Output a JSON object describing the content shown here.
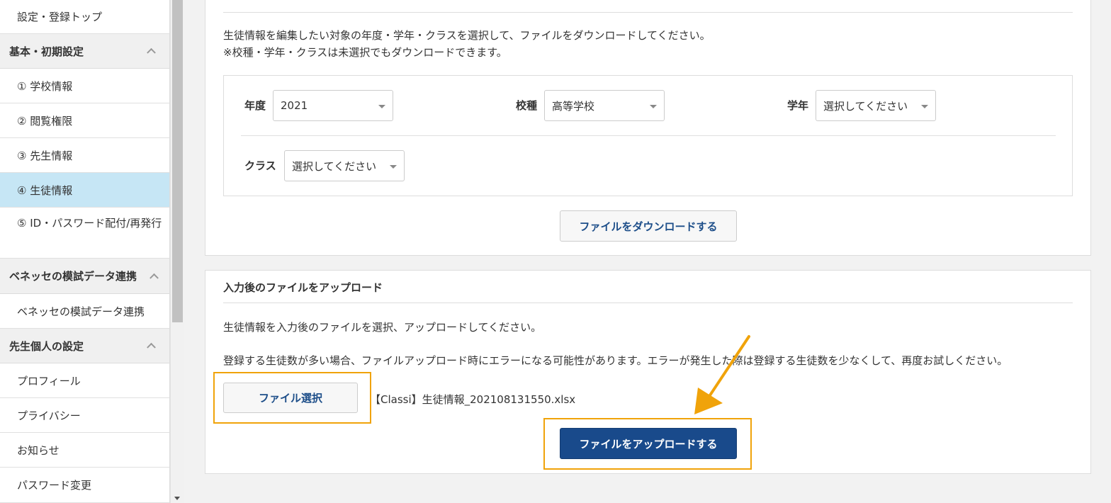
{
  "sidebar": {
    "top_item": "設定・登録トップ",
    "sections": [
      {
        "header": "基本・初期設定",
        "items": [
          "① 学校情報",
          "② 閲覧権限",
          "③ 先生情報",
          "④ 生徒情報",
          "⑤ ID・パスワード配付/再発行"
        ]
      },
      {
        "header": "ベネッセの模試データ連携",
        "items": [
          "ベネッセの模試データ連携"
        ]
      },
      {
        "header": "先生個人の設定",
        "items": [
          "プロフィール",
          "プライバシー",
          "お知らせ",
          "パスワード変更"
        ]
      }
    ],
    "active_item": "④ 生徒情報"
  },
  "download_panel": {
    "instruction_1": "生徒情報を編集したい対象の年度・学年・クラスを選択して、ファイルをダウンロードしてください。",
    "instruction_2": "※校種・学年・クラスは未選択でもダウンロードできます。",
    "filters": {
      "year_label": "年度",
      "year_value": "2021",
      "school_type_label": "校種",
      "school_type_value": "高等学校",
      "grade_label": "学年",
      "grade_value": "選択してください",
      "class_label": "クラス",
      "class_value": "選択してください"
    },
    "download_button": "ファイルをダウンロードする"
  },
  "upload_panel": {
    "title": "入力後のファイルをアップロード",
    "instruction_1": "生徒情報を入力後のファイルを選択、アップロードしてください。",
    "instruction_2": "登録する生徒数が多い場合、ファイルアップロード時にエラーになる可能性があります。エラーが発生した際は登録する生徒数を少なくして、再度お試しください。",
    "choose_file_button": "ファイル選択",
    "selected_file": "【Classi】生徒情報_202108131550.xlsx",
    "upload_button": "ファイルをアップロードする"
  },
  "colors": {
    "accent": "#194a8b",
    "highlight": "#f0a30a",
    "active_nav": "#c6e6f5"
  }
}
